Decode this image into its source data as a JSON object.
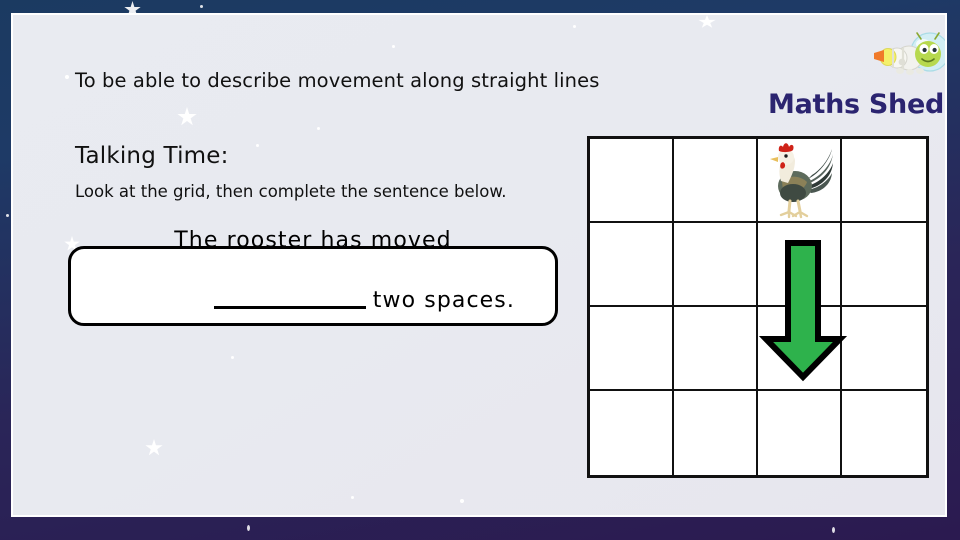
{
  "slide": {
    "objective": "To be able to describe movement along straight lines",
    "section_heading": "Talking Time:",
    "instruction": "Look at the grid, then complete the sentence below.",
    "background_color": "#e8eaf0",
    "border_gradient_top": "#1b3a61",
    "border_gradient_bottom": "#2b1a50"
  },
  "sentence_box": {
    "line1": "The rooster has moved",
    "blank_placeholder": "__________",
    "line2_after_blank": "two spaces.",
    "full_text": "The rooster has moved __________ two spaces.",
    "border_color": "#000000",
    "fill_color": "#ffffff"
  },
  "logo": {
    "wordmark": "Maths Shed",
    "wordmark_color": "#2b2470",
    "mascot": "caterpillar-astronaut-icon"
  },
  "grid": {
    "rows": 4,
    "columns": 4,
    "line_color": "#111111",
    "cell_fill": "#ffffff",
    "cells": [
      [
        {
          "content": ""
        },
        {
          "content": ""
        },
        {
          "content": "rooster-icon"
        },
        {
          "content": ""
        }
      ],
      [
        {
          "content": ""
        },
        {
          "content": ""
        },
        {
          "content": "arrow-shaft"
        },
        {
          "content": ""
        }
      ],
      [
        {
          "content": ""
        },
        {
          "content": ""
        },
        {
          "content": "arrow-head"
        },
        {
          "content": ""
        }
      ],
      [
        {
          "content": ""
        },
        {
          "content": ""
        },
        {
          "content": ""
        },
        {
          "content": ""
        }
      ]
    ],
    "rooster_position": {
      "row": 1,
      "column": 3
    },
    "arrow": {
      "direction": "down",
      "spans_rows": [
        2,
        3
      ],
      "column": 3,
      "fill_color": "#2eb24c",
      "outline_color": "#000000",
      "spaces_moved": 2
    }
  }
}
